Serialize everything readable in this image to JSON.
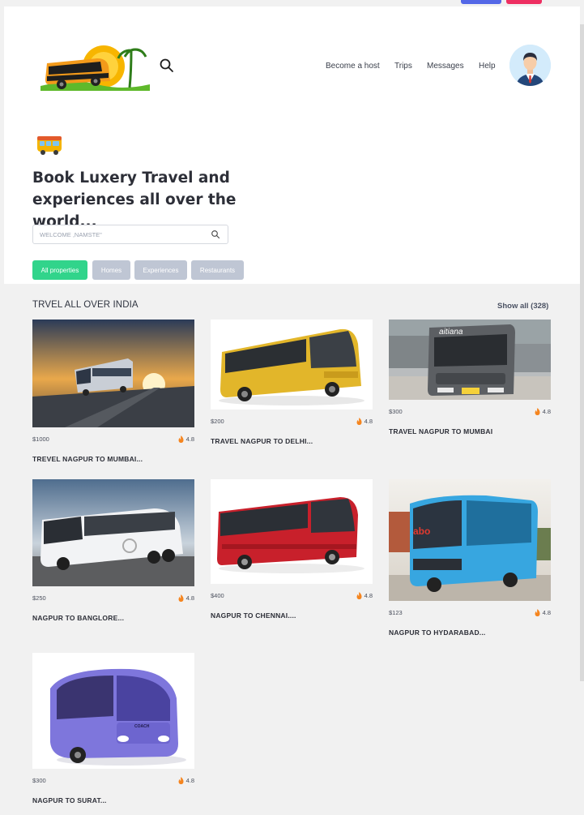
{
  "nav": {
    "become_host": "Become a host",
    "trips": "Trips",
    "messages": "Messages",
    "help": "Help"
  },
  "hero": {
    "headline_line1": "Book Luxery Travel and",
    "headline_line2": "experiences all over the world...",
    "search_placeholder": "WELCOME ,NAMSTE\""
  },
  "filters": [
    {
      "label": "All properties",
      "active": true
    },
    {
      "label": "Homes",
      "active": false
    },
    {
      "label": "Experiences",
      "active": false
    },
    {
      "label": "Restaurants",
      "active": false
    }
  ],
  "section": {
    "title": "TRVEL ALL OVER INDIA",
    "show_all": "Show all (328)"
  },
  "listings": [
    {
      "price": "$1000",
      "rating": "4.8",
      "title": "TREVEL NAGPUR TO MUMBAI..."
    },
    {
      "price": "$200",
      "rating": "4.8",
      "title": "TRAVEL NAGPUR TO DELHI..."
    },
    {
      "price": "$300",
      "rating": "4.8",
      "title": "TRAVEL NAGPUR TO MUMBAI"
    },
    {
      "price": "$250",
      "rating": "4.8",
      "title": "NAGPUR TO BANGLORE..."
    },
    {
      "price": "$400",
      "rating": "4.8",
      "title": "NAGPUR TO CHENNAI...."
    },
    {
      "price": "$123",
      "rating": "4.8",
      "title": "NAGPUR TO HYDARABAD..."
    },
    {
      "price": "$300",
      "rating": "4.8",
      "title": "NAGPUR TO SURAT..."
    }
  ],
  "photo_texts": {
    "bus3_sign": "aitiana",
    "bus6_brand": "abo",
    "bus7_label": "COACH"
  },
  "colors": {
    "active_chip": "#31d48b",
    "inactive_chip": "#bfc6d4",
    "rating_flame": "#f5851f"
  }
}
